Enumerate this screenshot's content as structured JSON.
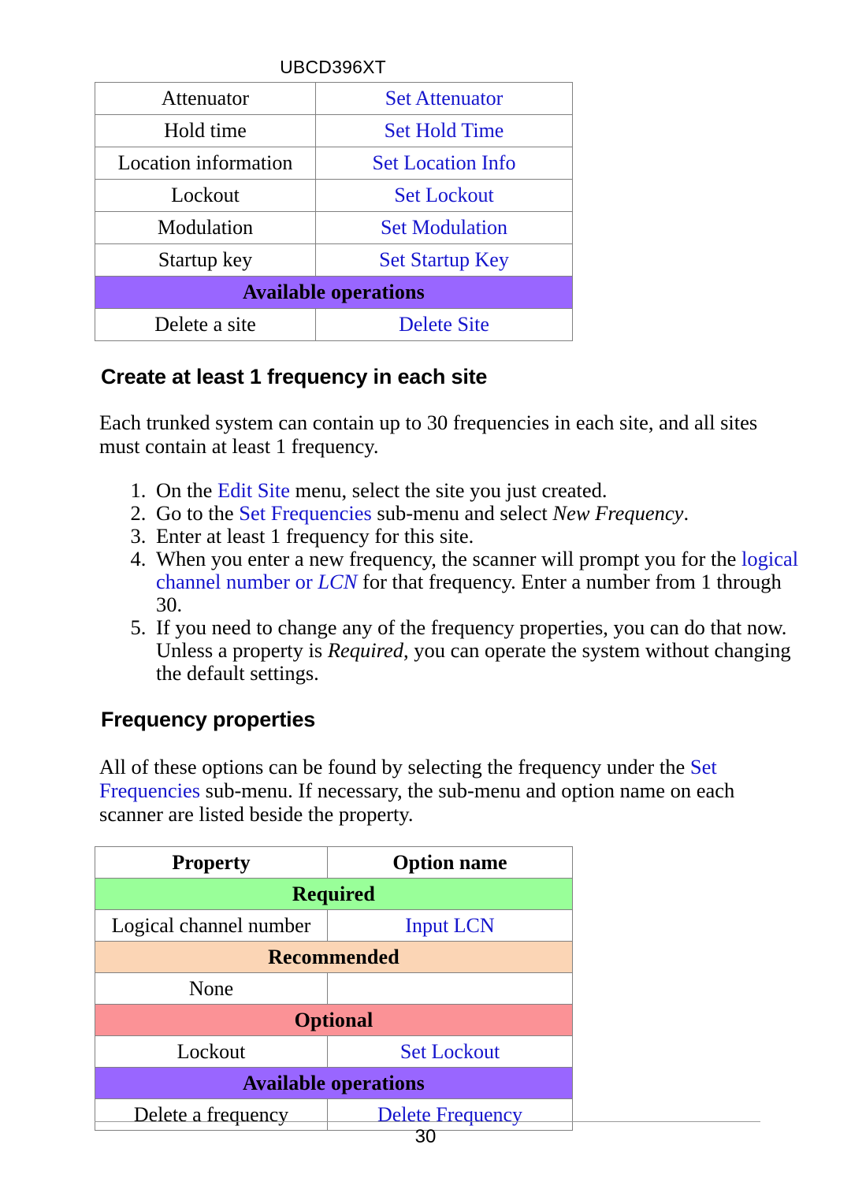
{
  "header": {
    "model": "UBCD396XT"
  },
  "site_table": {
    "rows": [
      {
        "type": "data",
        "property": "Attenuator",
        "option": "Set Attenuator"
      },
      {
        "type": "data",
        "property": "Hold time",
        "option": "Set Hold Time"
      },
      {
        "type": "data",
        "property": "Location information",
        "option": "Set Location Info"
      },
      {
        "type": "data",
        "property": "Lockout",
        "option": "Set Lockout"
      },
      {
        "type": "data",
        "property": "Modulation",
        "option": "Set Modulation"
      },
      {
        "type": "data",
        "property": "Startup key",
        "option": "Set Startup Key"
      },
      {
        "type": "category",
        "label": "Available operations",
        "color": "#9966ff"
      },
      {
        "type": "data",
        "property": "Delete a site",
        "option": "Delete Site"
      }
    ]
  },
  "section_create": {
    "heading": "Create at least 1 frequency in each site",
    "paragraph": "Each trunked system can contain up to 30 frequencies in each site, and all sites must contain at least 1 frequency.",
    "steps": [
      {
        "parts": [
          {
            "text": "On the ",
            "style": "plain"
          },
          {
            "text": "Edit Site",
            "style": "blue"
          },
          {
            "text": " menu, select the site you just created.",
            "style": "plain"
          }
        ]
      },
      {
        "parts": [
          {
            "text": "Go to the ",
            "style": "plain"
          },
          {
            "text": "Set Frequencies",
            "style": "blue"
          },
          {
            "text": " sub-menu and select ",
            "style": "plain"
          },
          {
            "text": "New Frequency",
            "style": "italic"
          },
          {
            "text": ".",
            "style": "plain"
          }
        ]
      },
      {
        "parts": [
          {
            "text": "Enter at least 1 frequency for this site.",
            "style": "plain"
          }
        ]
      },
      {
        "parts": [
          {
            "text": "When you enter a new frequency, the scanner will prompt you for the ",
            "style": "plain"
          },
          {
            "text": "logical channel number or ",
            "style": "blue"
          },
          {
            "text": "LCN",
            "style": "blue-italic"
          },
          {
            "text": " for that frequency. Enter a number from 1 through 30.",
            "style": "plain"
          }
        ]
      },
      {
        "parts": [
          {
            "text": "If you need to change any of the frequency properties, you can do that now. Unless a property is ",
            "style": "plain"
          },
          {
            "text": "Required",
            "style": "italic"
          },
          {
            "text": ", you can operate the system without changing the default settings.",
            "style": "plain"
          }
        ]
      }
    ]
  },
  "section_freqprops": {
    "heading": "Frequency properties",
    "paragraph_parts": [
      {
        "text": "All of these options can be found by selecting the frequency under the ",
        "style": "plain"
      },
      {
        "text": "Set Frequencies",
        "style": "blue"
      },
      {
        "text": " sub-menu. If necessary, the sub-menu and option name on each scanner are listed beside the property.",
        "style": "plain"
      }
    ]
  },
  "freq_table": {
    "columns": [
      "Property",
      "Option name"
    ],
    "rows": [
      {
        "type": "header",
        "property": "Property",
        "option": "Option name"
      },
      {
        "type": "category",
        "label": "Required",
        "color": "#99ff99"
      },
      {
        "type": "data",
        "property": "Logical channel number",
        "option": "Input LCN"
      },
      {
        "type": "category",
        "label": "Recommended",
        "color": "#fbd5b5"
      },
      {
        "type": "data",
        "property": "None",
        "option": ""
      },
      {
        "type": "category",
        "label": "Optional",
        "color": "#fb9296"
      },
      {
        "type": "data",
        "property": "Lockout",
        "option": "Set Lockout"
      },
      {
        "type": "category",
        "label": "Available operations",
        "color": "#9966ff"
      },
      {
        "type": "data",
        "property": "Delete a frequency",
        "option": "Delete Frequency"
      }
    ]
  },
  "footer": {
    "page_number": "30"
  },
  "colors": {
    "link_blue": "#1414cc",
    "category_purple": "#9966ff",
    "category_green": "#99ff99",
    "category_peach": "#fbd5b5",
    "category_red": "#fb9296",
    "border_gray": "#808080"
  }
}
